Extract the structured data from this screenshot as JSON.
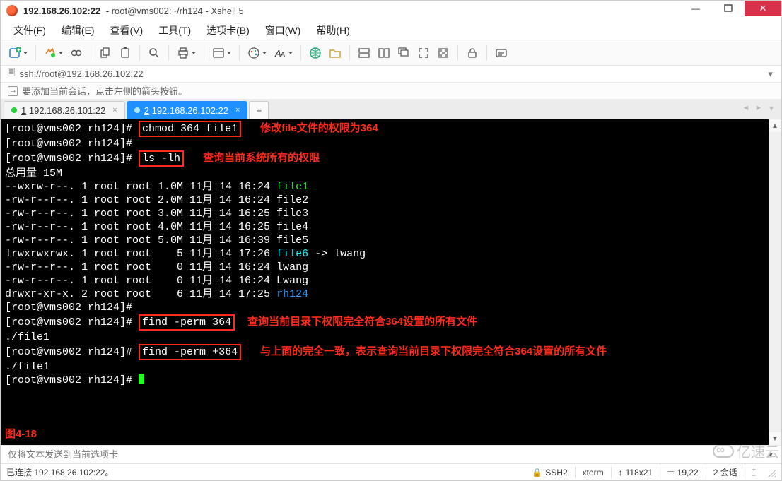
{
  "window": {
    "title_host": "192.168.26.102:22",
    "title_rest": "root@vms002:~/rh124 - Xshell 5"
  },
  "menus": {
    "file": "文件(F)",
    "edit": "编辑(E)",
    "view": "查看(V)",
    "tools": "工具(T)",
    "tabs": "选项卡(B)",
    "window": "窗口(W)",
    "help": "帮助(H)"
  },
  "address": {
    "icon": "🗏",
    "url": "ssh://root@192.168.26.102:22"
  },
  "hint": {
    "text": "要添加当前会话，点击左侧的箭头按钮。"
  },
  "tabs": {
    "tab1": {
      "bullet": "●",
      "num": "1",
      "label": "192.168.26.101:22",
      "close": "×"
    },
    "tab2": {
      "bullet": "●",
      "num": "2",
      "label": "192.168.26.102:22",
      "close": "×"
    },
    "add": "+"
  },
  "term": {
    "p1": "[root@vms002 rh124]#",
    "cmd1": "chmod 364 file1",
    "note1": "修改file文件的权限为364",
    "p2": "[root@vms002 rh124]#",
    "p3": "[root@vms002 rh124]#",
    "cmd2": "ls -lh",
    "note2": "查询当前系统所有的权限",
    "total": "总用量 15M",
    "l1a": "--wxrw-r--. 1 root root 1.0M 11月 14 16:24 ",
    "l1b": "file1",
    "l2": "-rw-r--r--. 1 root root 2.0M 11月 14 16:24 file2",
    "l3": "-rw-r--r--. 1 root root 3.0M 11月 14 16:25 file3",
    "l4": "-rw-r--r--. 1 root root 4.0M 11月 14 16:25 file4",
    "l5": "-rw-r--r--. 1 root root 5.0M 11月 14 16:39 file5",
    "l6a": "lrwxrwxrwx. 1 root root    5 11月 14 17:26 ",
    "l6b": "file6",
    "l6c": " -> lwang",
    "l7": "-rw-r--r--. 1 root root    0 11月 14 16:24 lwang",
    "l8": "-rw-r--r--. 1 root root    0 11月 14 16:24 Lwang",
    "l9a": "drwxr-xr-x. 2 root root    6 11月 14 17:25 ",
    "l9b": "rh124",
    "p4": "[root@vms002 rh124]#",
    "p5": "[root@vms002 rh124]#",
    "cmd3": "find -perm 364",
    "note3": "查询当前目录下权限完全符合364设置的所有文件",
    "out1": "./file1",
    "p6": "[root@vms002 rh124]#",
    "cmd4": "find -perm +364",
    "note4": "与上面的完全一致，表示查询当前目录下权限完全符合364设置的所有文件",
    "out2": "./file1",
    "p7": "[root@vms002 rh124]# ",
    "figlabel": "图4-18"
  },
  "sendbar": {
    "placeholder": "仅将文本发送到当前选项卡"
  },
  "status": {
    "left": "已连接 192.168.26.102:22。",
    "ssh_icon": "🔒",
    "ssh": "SSH2",
    "term": "xterm",
    "size_icon": "↕",
    "size": "118x21",
    "pos_icon": "⎓",
    "pos": "19,22",
    "sessions": "2 会话",
    "sess_icon": "↕",
    "caps_plus": "+",
    "caps_minus": "−"
  },
  "watermark": "亿速云"
}
